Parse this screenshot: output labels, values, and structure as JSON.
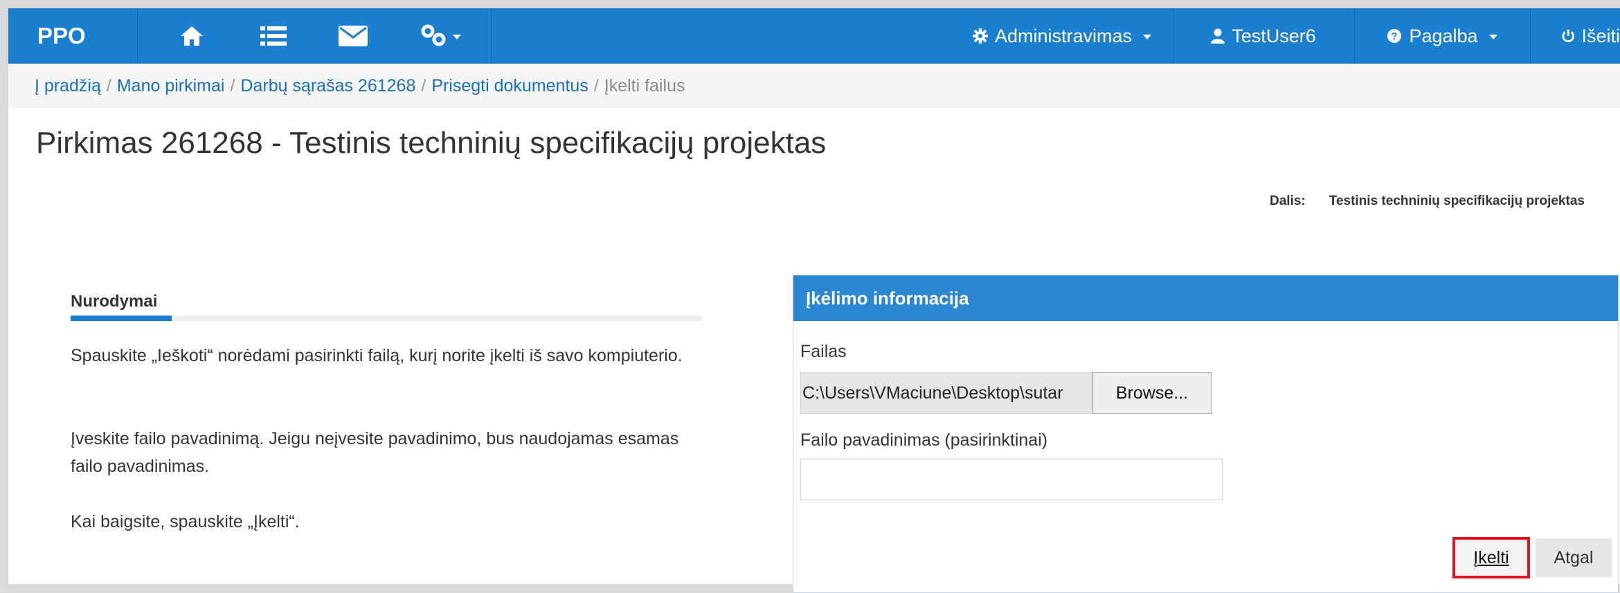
{
  "navbar": {
    "brand": "PPO",
    "icons": [
      "home-icon",
      "list-icon",
      "envelope-icon",
      "link-icon"
    ],
    "admin_label": "Administravimas",
    "user_label": "TestUser6",
    "help_label": "Pagalba",
    "logout_label": "Išeiti"
  },
  "breadcrumb": {
    "home": "Į pradžią",
    "purchases": "Mano pirkimai",
    "work_list": "Darbų sąrašas 261268",
    "attach": "Prisegti dokumentus",
    "current": "Įkelti failus",
    "separator": "/"
  },
  "page": {
    "title": "Pirkimas 261268 - Testinis techninių specifikacijų projektas",
    "dalis_label": "Dalis:",
    "dalis_value": "Testinis techninių specifikacijų projektas"
  },
  "instructions": {
    "heading": "Nurodymai",
    "p1": "Spauskite „Ieškoti“ norėdami pasirinkti failą, kurį norite įkelti iš savo kompiuterio.",
    "p2": "Įveskite failo pavadinimą. Jeigu neįvesite pavadinimo, bus naudojamas esamas failo pavadinimas.",
    "p3": "Kai baigsite, spauskite „Įkelti“."
  },
  "upload_panel": {
    "heading": "Įkėlimo informacija",
    "file_label": "Failas",
    "file_value": "C:\\Users\\VMaciune\\Desktop\\sutar",
    "browse_label": "Browse...",
    "name_label": "Failo pavadinimas (pasirinktinai)",
    "name_value": "",
    "upload_label": "Įkelti",
    "back_label": "Atgal"
  },
  "colors": {
    "navbar": "#1a7ed1",
    "panel_header": "#2b86d1",
    "link": "#1a6fbf",
    "highlight": "#e0141d"
  }
}
